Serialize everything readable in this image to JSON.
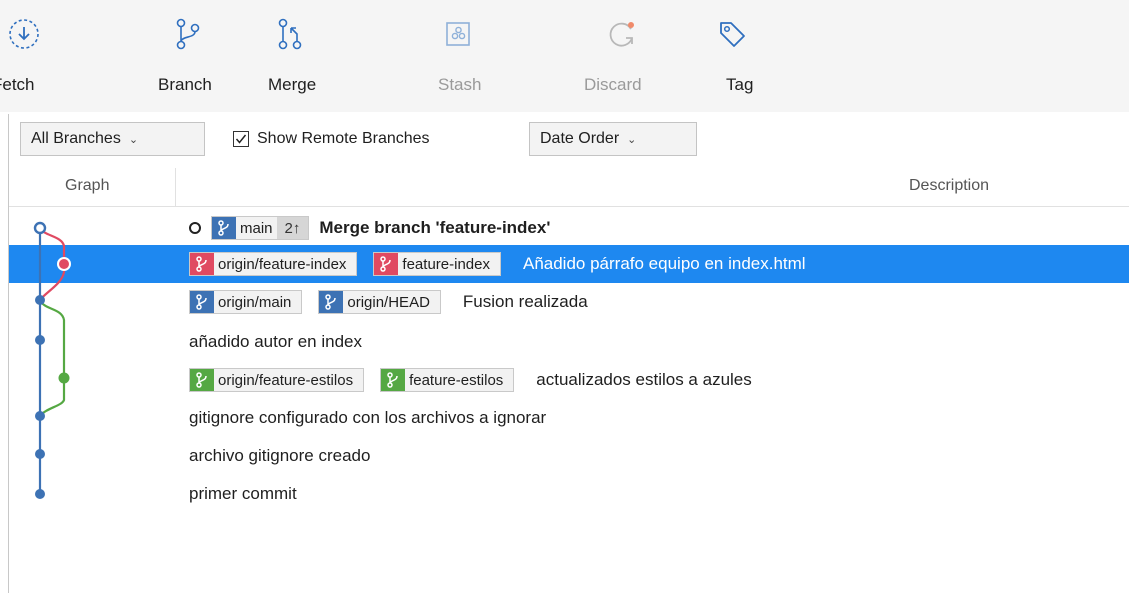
{
  "toolbar": {
    "fetch": "Fetch",
    "branch": "Branch",
    "merge": "Merge",
    "stash": "Stash",
    "discard": "Discard",
    "tag": "Tag"
  },
  "filters": {
    "branches": "All Branches",
    "show_remote": "Show Remote Branches",
    "show_remote_checked": true,
    "order": "Date Order"
  },
  "columns": {
    "graph": "Graph",
    "description": "Description"
  },
  "commits": [
    {
      "message": "Merge branch 'feature-index'",
      "bold": true,
      "head": true,
      "tags": [
        {
          "label": "main",
          "color": "blue",
          "count": "2↑"
        }
      ]
    },
    {
      "message": "Añadido párrafo equipo en index.html",
      "selected": true,
      "tags": [
        {
          "label": "origin/feature-index",
          "color": "red"
        },
        {
          "label": "feature-index",
          "color": "red"
        }
      ]
    },
    {
      "message": "Fusion realizada",
      "tags": [
        {
          "label": "origin/main",
          "color": "blue"
        },
        {
          "label": "origin/HEAD",
          "color": "blue"
        }
      ]
    },
    {
      "message": "añadido autor en index",
      "tags": []
    },
    {
      "message": "actualizados estilos a azules",
      "tags": [
        {
          "label": "origin/feature-estilos",
          "color": "green"
        },
        {
          "label": "feature-estilos",
          "color": "green"
        }
      ]
    },
    {
      "message": "gitignore configurado con los archivos a ignorar",
      "tags": []
    },
    {
      "message": "archivo gitignore creado",
      "tags": []
    },
    {
      "message": "primer commit",
      "tags": []
    }
  ],
  "colors": {
    "main_branch": "#3d72b4",
    "feature_index": "#e04a62",
    "feature_estilos": "#55a843",
    "selection": "#1e88f0"
  }
}
